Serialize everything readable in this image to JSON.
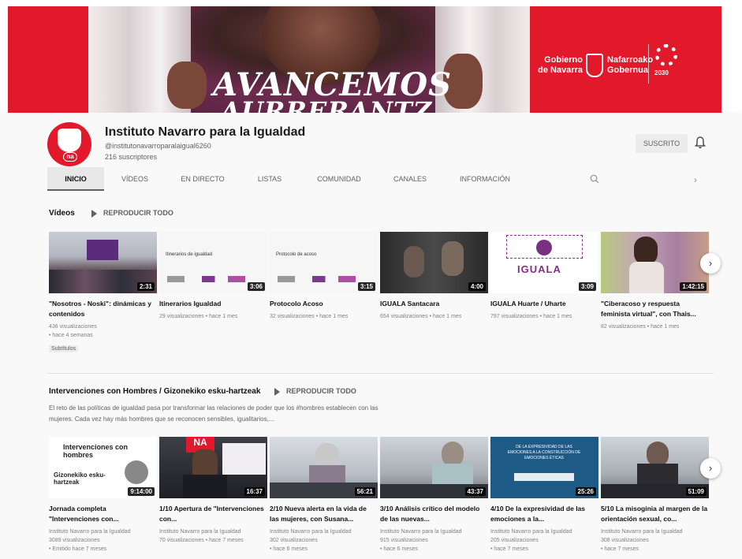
{
  "banner": {
    "headline1": "AVANCEMOS",
    "headline2": "AURRERANTZ",
    "gov_es": "Gobierno de Navarra",
    "gov_eu": "Nafarroako Gobernua",
    "agenda_label": "2030"
  },
  "channel": {
    "avatar_label": "na",
    "name": "Instituto Navarro para la Igualdad",
    "handle": "@institutonavarroparalaigual6260",
    "subscribers": "216 suscriptores",
    "subscribe_label": "SUSCRITO"
  },
  "tabs": [
    {
      "label": "INICIO"
    },
    {
      "label": "VÍDEOS"
    },
    {
      "label": "EN DIRECTO"
    },
    {
      "label": "LISTAS"
    },
    {
      "label": "COMUNIDAD"
    },
    {
      "label": "CANALES"
    },
    {
      "label": "INFORMACIÓN"
    }
  ],
  "section1": {
    "title": "Vídeos",
    "play_all": "REPRODUCIR TODO",
    "videos": [
      {
        "title": "\"Nosotros - Noski\": dinámicas y contenidos",
        "duration": "2:31",
        "meta1": "436 visualizaciones",
        "meta2": "• hace 4 semanas",
        "badge": "Subtítulos"
      },
      {
        "title": "Itinerarios Igualdad",
        "duration": "3:06",
        "meta1": "29 visualizaciones • hace 1 mes",
        "thumb_text": "Itinerarios de igualdad"
      },
      {
        "title": "Protocolo Acoso",
        "duration": "3:15",
        "meta1": "32 visualizaciones • hace 1 mes",
        "thumb_text": "Protocolo de acoso"
      },
      {
        "title": "IGUALA Santacara",
        "duration": "4:00",
        "meta1": "654 visualizaciones • hace 1 mes"
      },
      {
        "title": "IGUALA Huarte / Uharte",
        "duration": "3:09",
        "meta1": "797 visualizaciones • hace 1 mes",
        "thumb_text": "IGUALA"
      },
      {
        "title": "\"Ciberacoso y respuesta feminista virtual\", con Thais...",
        "duration": "1:42:15",
        "meta1": "82 visualizaciones • hace 1 mes"
      }
    ]
  },
  "section2": {
    "title": "Intervenciones con Hombres / Gizonekiko esku-hartzeak",
    "play_all": "REPRODUCIR TODO",
    "description": "El reto de las políticas de igualdad pasa por transformar las relaciones de poder que los #hombres establecen con las mujeres. Cada vez hay más hombres que se reconocen sensibles, igualitarios,...",
    "videos": [
      {
        "title": "Jornada completa \"Intervenciones con...",
        "duration": "9:14:00",
        "meta1": "Instituto Navarro para la Igualdad",
        "meta2": "3089 visualizaciones",
        "meta3": "• Emitido hace 7 meses",
        "thumb_text1": "Intervenciones con hombres",
        "thumb_text2": "Gizonekiko esku-hartzeak"
      },
      {
        "title": "1/10 Apertura de \"Intervenciones con...",
        "duration": "16:37",
        "meta1": "Instituto Navarro para la Igualdad",
        "meta2": "70 visualizaciones • hace 7 meses",
        "thumb_text": "NA"
      },
      {
        "title": "2/10 Nueva alerta en la vida de las mujeres, con Susana...",
        "duration": "56:21",
        "meta1": "Instituto Navarro para la Igualdad",
        "meta2": "302 visualizaciones",
        "meta3": "• hace 6 meses"
      },
      {
        "title": "3/10 Análisis crítico del modelo de las nuevas...",
        "duration": "43:37",
        "meta1": "Instituto Navarro para la Igualdad",
        "meta2": "915 visualizaciones",
        "meta3": "• hace 6 meses"
      },
      {
        "title": "4/10 De la expresividad de las emociones a la...",
        "duration": "25:26",
        "meta1": "Instituto Navarro para la Igualdad",
        "meta2": "205 visualizaciones",
        "meta3": "• hace 7 meses",
        "thumb_text": "DE LA EXPRESIVIDAD DE LAS EMOCIONES A LA CONSTRUCCIÓN DE EMOCIONES ÉTICAS"
      },
      {
        "title": "5/10 La misoginia al margen de la orientación sexual, co...",
        "duration": "51:09",
        "meta1": "Instituto Navarro para la Igualdad",
        "meta2": "308 visualizaciones",
        "meta3": "• hace 7 meses"
      }
    ]
  },
  "icons": {
    "bell": "bell-icon",
    "search": "search-icon",
    "next": "chevron-right-icon",
    "play": "play-icon"
  },
  "colors": {
    "brand_red": "#e1192b",
    "purple": "#8a2b8c"
  }
}
